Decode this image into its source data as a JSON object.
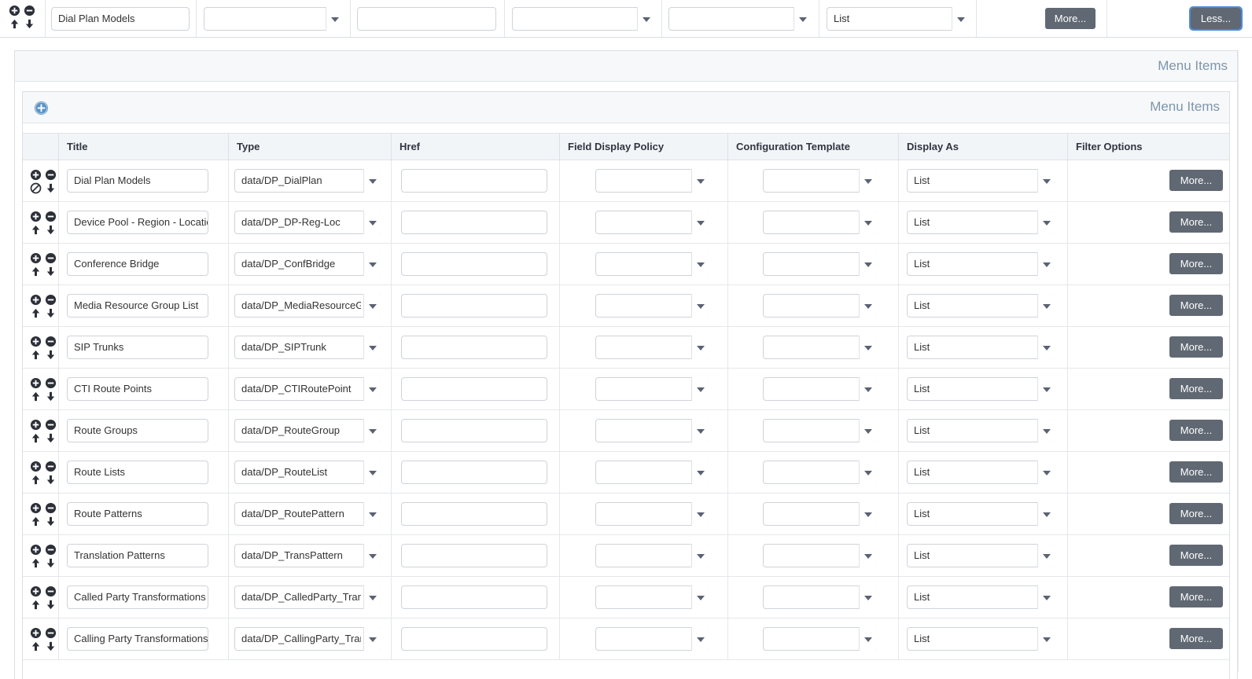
{
  "toolbar": {
    "title_value": "Dial Plan Models",
    "type_value": "",
    "href_value": "",
    "field_display_policy_value": "",
    "configuration_template_value": "",
    "display_as_value": "List",
    "more_label": "More...",
    "less_label": "Less...",
    "move_icons": [
      "move-add-icon",
      "move-remove-icon",
      "move-up-icon",
      "move-down-icon"
    ]
  },
  "outer_panel": {
    "legend": "Menu Items"
  },
  "inner_panel": {
    "legend": "Menu Items",
    "add_icon": "add-circle-icon"
  },
  "table": {
    "columns": [
      {
        "key": "actions",
        "label": ""
      },
      {
        "key": "title",
        "label": "Title"
      },
      {
        "key": "type",
        "label": "Type"
      },
      {
        "key": "href",
        "label": "Href"
      },
      {
        "key": "field_display_policy",
        "label": "Field Display Policy"
      },
      {
        "key": "configuration_template",
        "label": "Configuration Template"
      },
      {
        "key": "display_as",
        "label": "Display As"
      },
      {
        "key": "filter_options",
        "label": "Filter Options"
      }
    ],
    "more_label": "More...",
    "rows": [
      {
        "actions": [
          "add-circle-icon",
          "remove-circle-icon",
          "move-up-disabled-icon",
          "move-down-icon"
        ],
        "title": "Dial Plan Models",
        "type": "data/DP_DialPlan",
        "href": "",
        "field_display_policy": "",
        "configuration_template": "",
        "display_as": "List"
      },
      {
        "actions": [
          "add-circle-icon",
          "remove-circle-icon",
          "move-up-icon",
          "move-down-icon"
        ],
        "title": "Device Pool - Region - Location",
        "type": "data/DP_DP-Reg-Loc",
        "href": "",
        "field_display_policy": "",
        "configuration_template": "",
        "display_as": "List"
      },
      {
        "actions": [
          "add-circle-icon",
          "remove-circle-icon",
          "move-up-icon",
          "move-down-icon"
        ],
        "title": "Conference Bridge",
        "type": "data/DP_ConfBridge",
        "href": "",
        "field_display_policy": "",
        "configuration_template": "",
        "display_as": "List"
      },
      {
        "actions": [
          "add-circle-icon",
          "remove-circle-icon",
          "move-up-icon",
          "move-down-icon"
        ],
        "title": "Media Resource Group List",
        "type": "data/DP_MediaResourceGroupList",
        "href": "",
        "field_display_policy": "",
        "configuration_template": "",
        "display_as": "List"
      },
      {
        "actions": [
          "add-circle-icon",
          "remove-circle-icon",
          "move-up-icon",
          "move-down-icon"
        ],
        "title": "SIP Trunks",
        "type": "data/DP_SIPTrunk",
        "href": "",
        "field_display_policy": "",
        "configuration_template": "",
        "display_as": "List"
      },
      {
        "actions": [
          "add-circle-icon",
          "remove-circle-icon",
          "move-up-icon",
          "move-down-icon"
        ],
        "title": "CTI Route Points",
        "type": "data/DP_CTIRoutePoint",
        "href": "",
        "field_display_policy": "",
        "configuration_template": "",
        "display_as": "List"
      },
      {
        "actions": [
          "add-circle-icon",
          "remove-circle-icon",
          "move-up-icon",
          "move-down-icon"
        ],
        "title": "Route Groups",
        "type": "data/DP_RouteGroup",
        "href": "",
        "field_display_policy": "",
        "configuration_template": "",
        "display_as": "List"
      },
      {
        "actions": [
          "add-circle-icon",
          "remove-circle-icon",
          "move-up-icon",
          "move-down-icon"
        ],
        "title": "Route Lists",
        "type": "data/DP_RouteList",
        "href": "",
        "field_display_policy": "",
        "configuration_template": "",
        "display_as": "List"
      },
      {
        "actions": [
          "add-circle-icon",
          "remove-circle-icon",
          "move-up-icon",
          "move-down-icon"
        ],
        "title": "Route Patterns",
        "type": "data/DP_RoutePattern",
        "href": "",
        "field_display_policy": "",
        "configuration_template": "",
        "display_as": "List"
      },
      {
        "actions": [
          "add-circle-icon",
          "remove-circle-icon",
          "move-up-icon",
          "move-down-icon"
        ],
        "title": "Translation Patterns",
        "type": "data/DP_TransPattern",
        "href": "",
        "field_display_policy": "",
        "configuration_template": "",
        "display_as": "List"
      },
      {
        "actions": [
          "add-circle-icon",
          "remove-circle-icon",
          "move-up-icon",
          "move-down-icon"
        ],
        "title": "Called Party Transformations",
        "type": "data/DP_CalledParty_Transformation",
        "href": "",
        "field_display_policy": "",
        "configuration_template": "",
        "display_as": "List"
      },
      {
        "actions": [
          "add-circle-icon",
          "remove-circle-icon",
          "move-up-icon",
          "move-down-icon"
        ],
        "title": "Calling Party Transformations",
        "type": "data/DP_CallingParty_Transformation",
        "href": "",
        "field_display_policy": "",
        "configuration_template": "",
        "display_as": "List"
      }
    ]
  },
  "colors": {
    "button_grey": "#606873",
    "legend_blue": "#7c96ad",
    "focus_blue": "#4c8bd9",
    "header_bg": "#f2f5f8",
    "panel_header_bg": "#f7f8f9"
  }
}
